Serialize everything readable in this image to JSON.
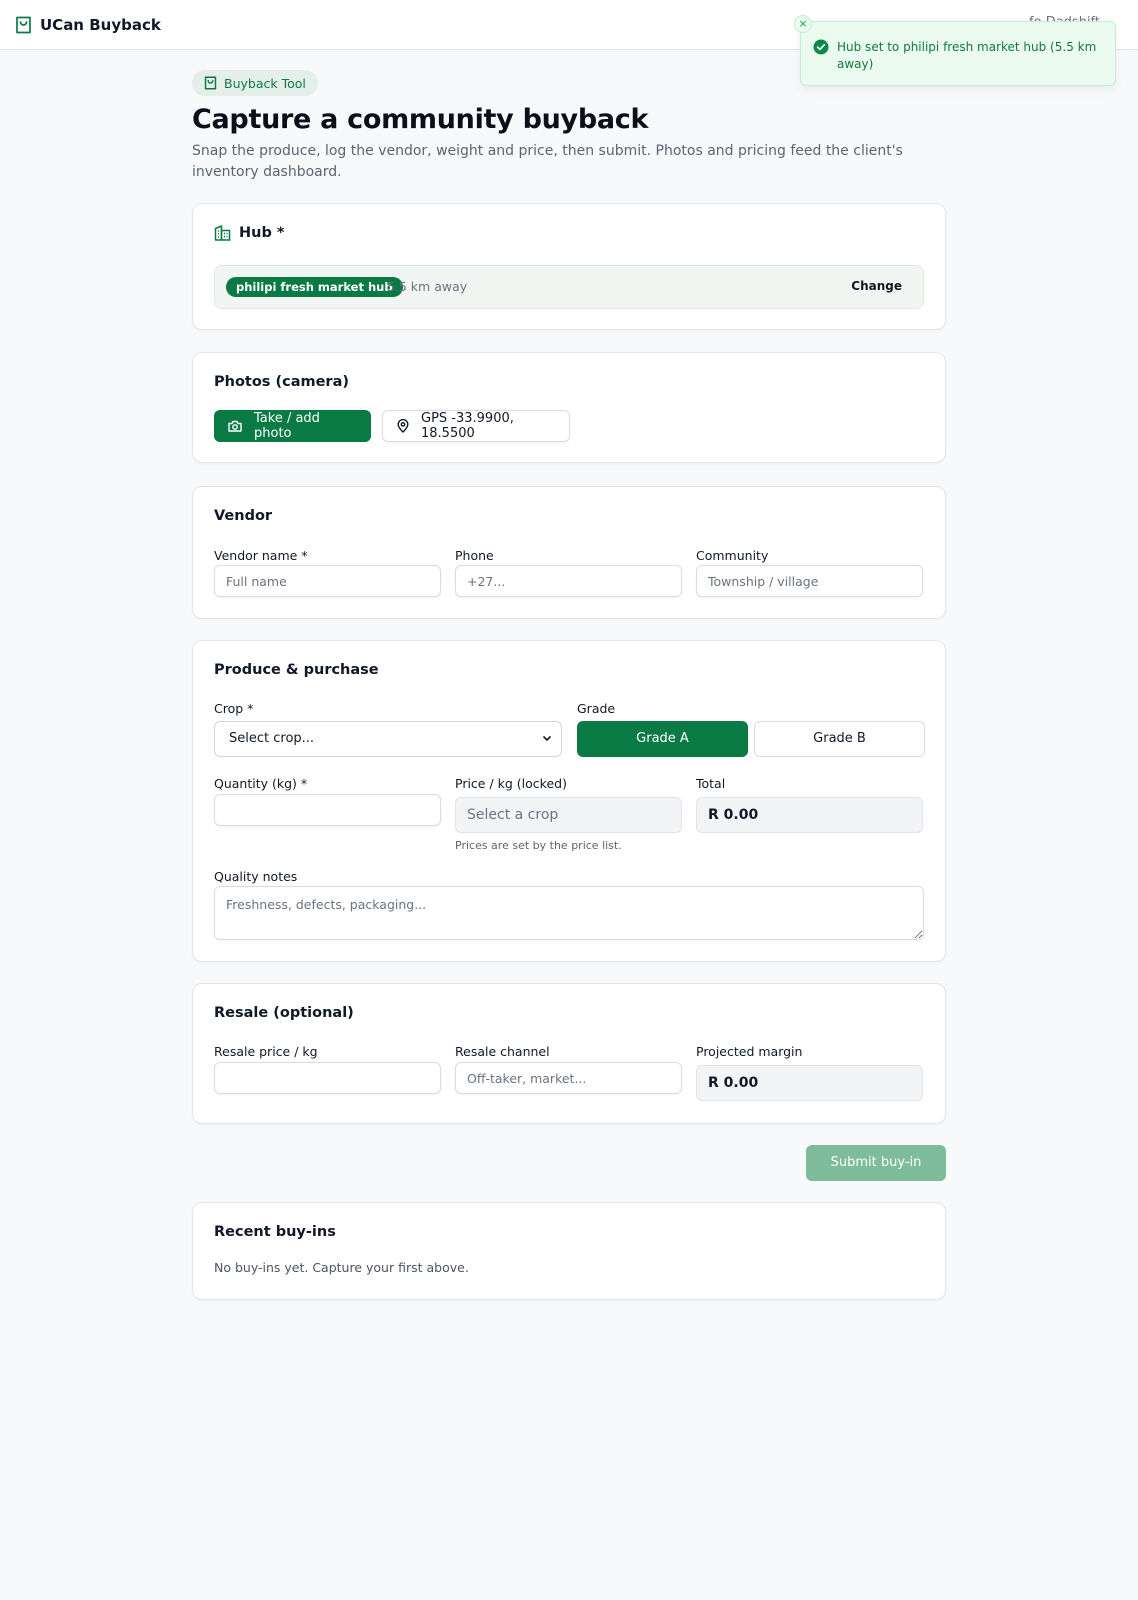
{
  "app": {
    "name": "UCan Buyback",
    "header_right": "fo Dadshift"
  },
  "toast": {
    "message": "Hub set to philipi fresh market hub (5.5 km away)",
    "close": "×"
  },
  "page": {
    "badge": "Buyback Tool",
    "title": "Capture a community buyback",
    "subtitle": "Snap the produce, log the vendor, weight and price, then submit. Photos and pricing feed the client's inventory dashboard."
  },
  "hub": {
    "title": "Hub *",
    "selected": "philipi fresh market hub",
    "distance": "· 5.5 km away",
    "change_label": "Change"
  },
  "photos": {
    "title": "Photos (camera)",
    "take_photo_label": "Take / add photo",
    "gps_label": "GPS -33.9900, 18.5500"
  },
  "vendor": {
    "title": "Vendor",
    "name_label": "Vendor name *",
    "name_placeholder": "Full name",
    "phone_label": "Phone",
    "phone_placeholder": "+27...",
    "community_label": "Community",
    "community_placeholder": "Township / village"
  },
  "produce": {
    "title": "Produce & purchase",
    "crop_label": "Crop *",
    "crop_value": "Select crop...",
    "grade_label": "Grade",
    "grades": [
      "Grade A",
      "Grade B"
    ],
    "selected_grade": "Grade A",
    "quantity_label": "Quantity (kg) *",
    "quantity_value": "",
    "price_label": "Price / kg (locked)",
    "price_value": "Select a crop",
    "price_hint": "Prices are set by the price list.",
    "total_label": "Total",
    "total_value": "R 0.00",
    "notes_label": "Quality notes",
    "notes_placeholder": "Freshness, defects, packaging..."
  },
  "resale": {
    "title": "Resale (optional)",
    "price_label": "Resale price / kg",
    "price_value": "",
    "channel_label": "Resale channel",
    "channel_placeholder": "Off-taker, market...",
    "margin_label": "Projected margin",
    "margin_value": "R 0.00"
  },
  "submit": {
    "label": "Submit buy-in"
  },
  "recent": {
    "title": "Recent buy-ins",
    "empty_text": "No buy-ins yet. Capture your first above."
  },
  "colors": {
    "brand": "#0a7a45",
    "brand_light": "#e3efe8",
    "toast_bg": "#ebfbf0",
    "submit_disabled": "#7fbc9c"
  },
  "icons": {
    "brand": "shopping-bag-icon",
    "badge": "shopping-bag-icon",
    "hub": "building-icon",
    "camera": "camera-icon",
    "gps": "map-pin-icon",
    "toast": "check-circle-icon"
  }
}
